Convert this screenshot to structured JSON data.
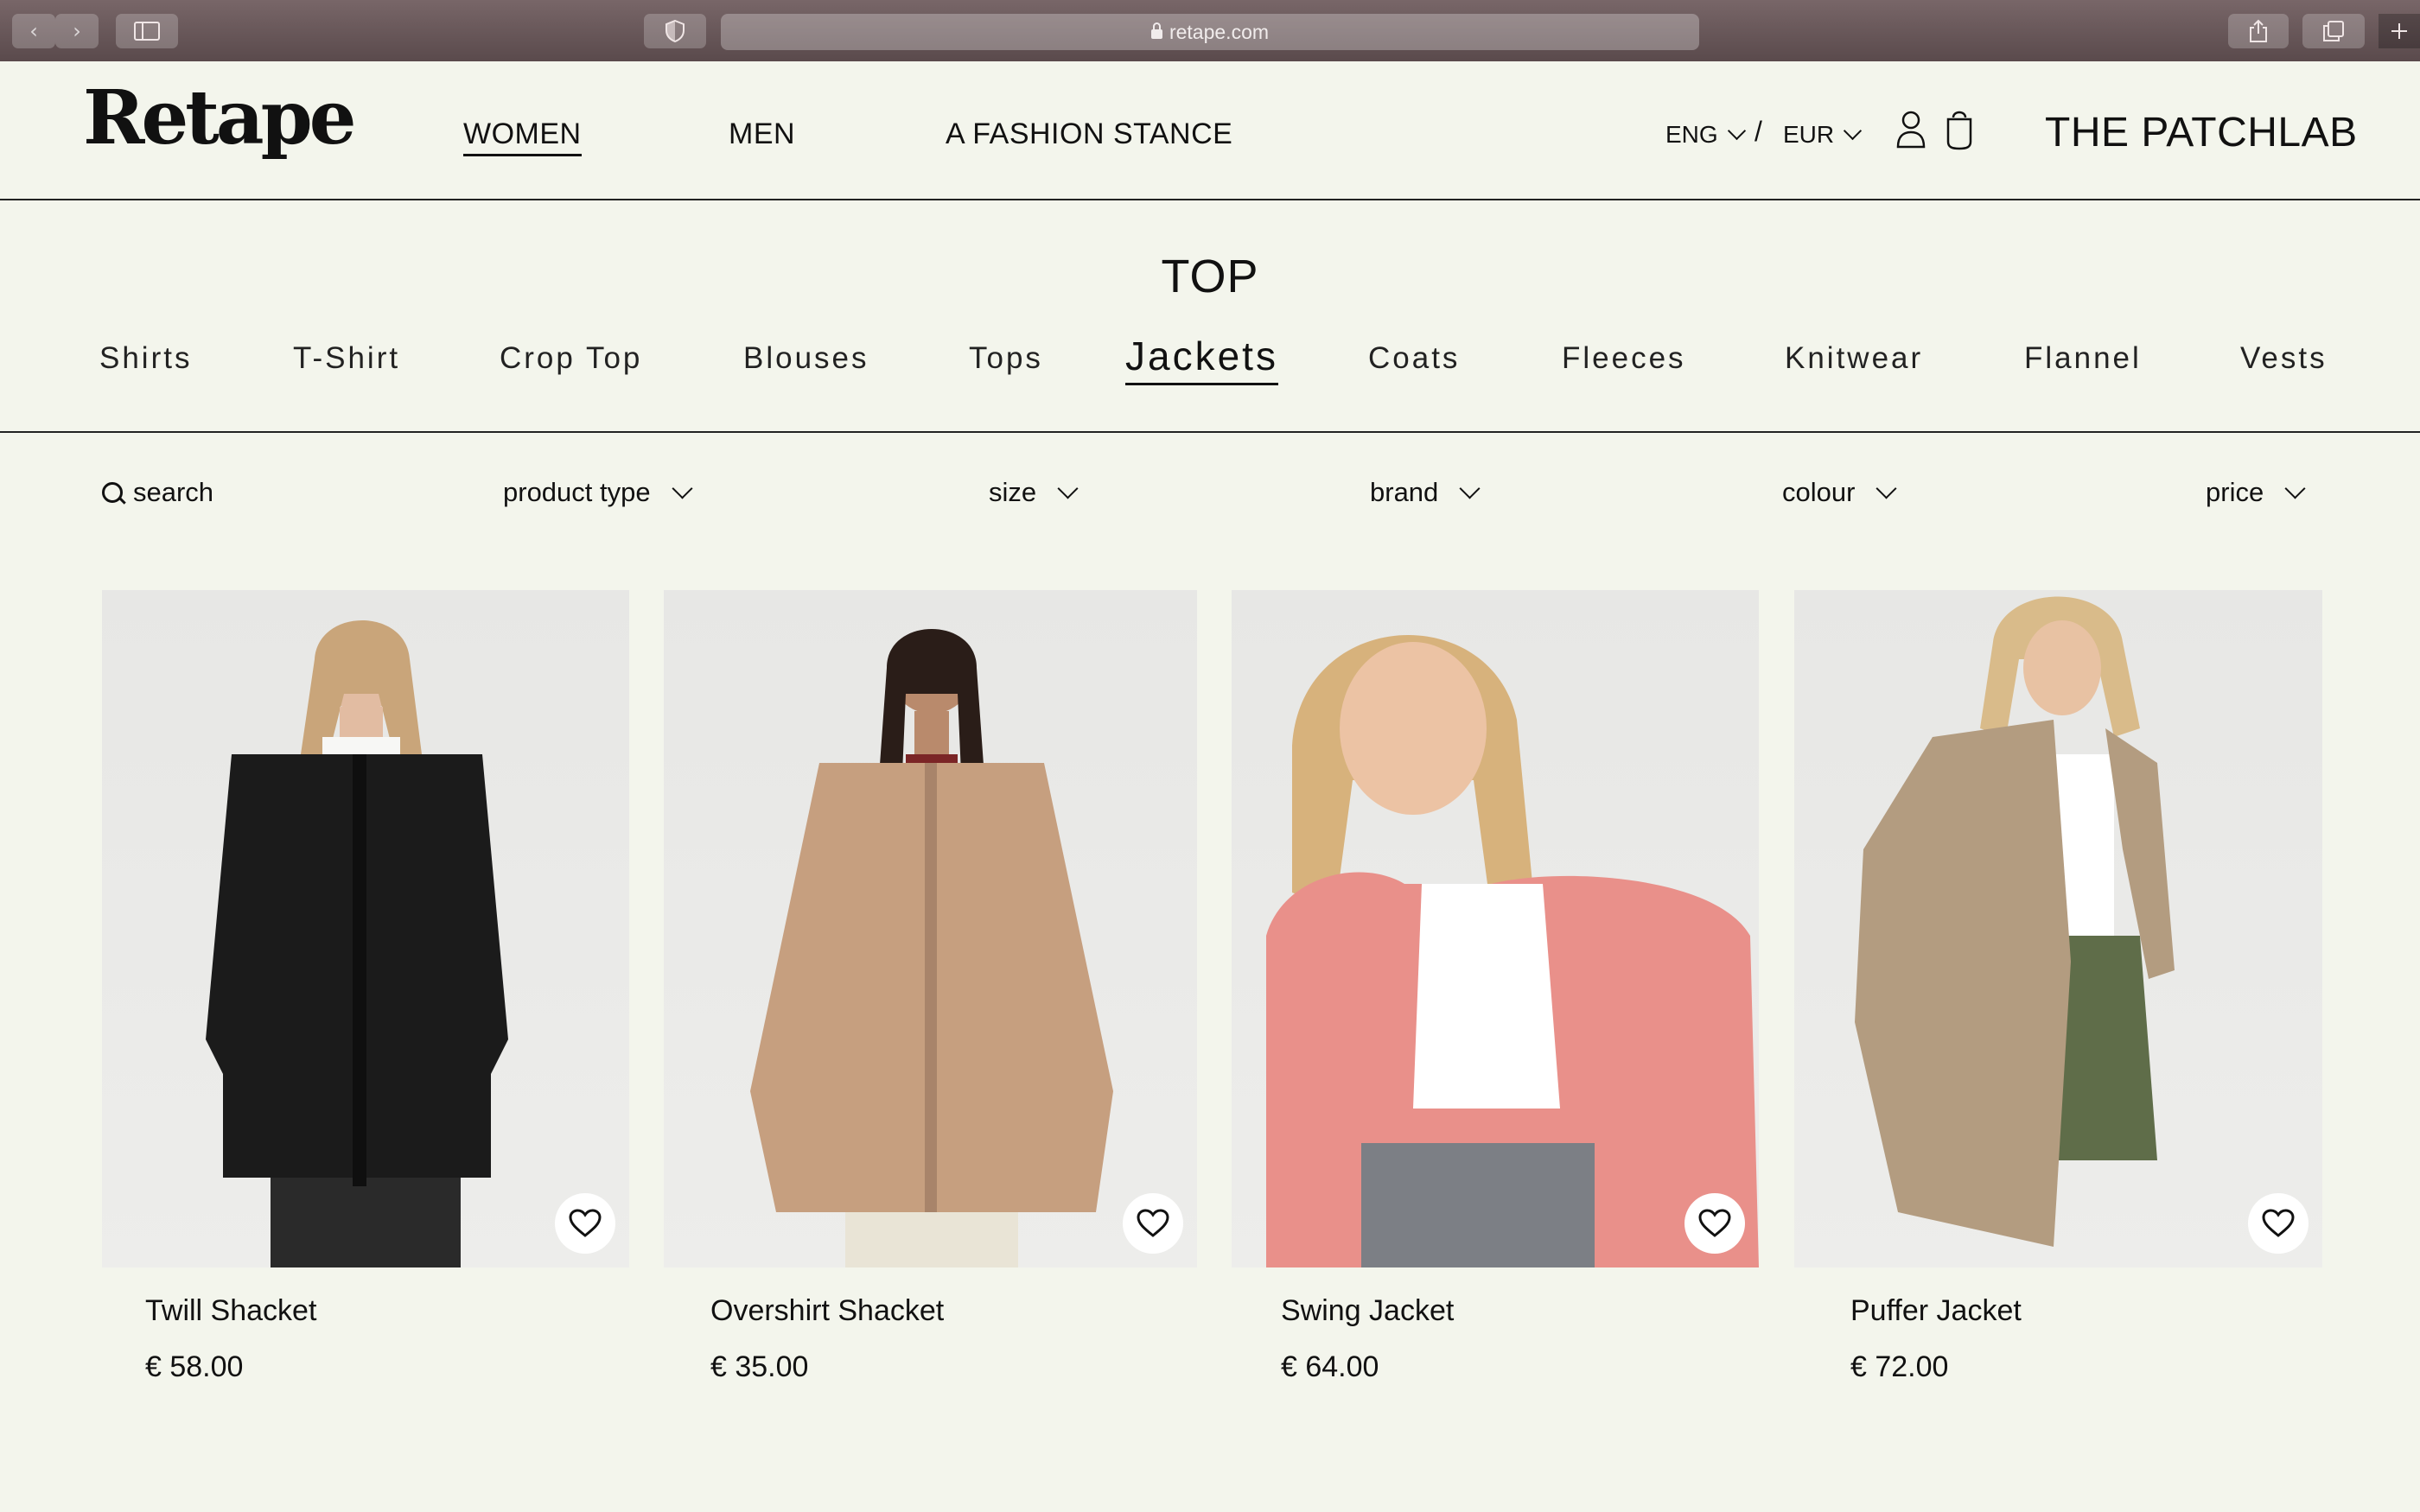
{
  "browser": {
    "url": "retape.com"
  },
  "header": {
    "logo": "Retape",
    "nav": [
      "WOMEN",
      "MEN",
      "A FASHION STANCE"
    ],
    "language": "ENG",
    "currency": "EUR",
    "separator": "/",
    "brand": "THE PATCHLAB"
  },
  "category": {
    "title": "TOP",
    "subcategories": [
      "Shirts",
      "T-Shirt",
      "Crop Top",
      "Blouses",
      "Tops",
      "Jackets",
      "Coats",
      "Fleeces",
      "Knitwear",
      "Flannel",
      "Vests"
    ],
    "active": "Jackets"
  },
  "filters": {
    "search": "search",
    "product_type": "product type",
    "size": "size",
    "brand": "brand",
    "colour": "colour",
    "price": "price"
  },
  "products": [
    {
      "name": "Twill Shacket",
      "price": "€ 58.00",
      "color": "#1b1b1b"
    },
    {
      "name": "Overshirt Shacket",
      "price": "€ 35.00",
      "color": "#c69f7f"
    },
    {
      "name": "Swing Jacket",
      "price": "€ 64.00",
      "color": "#e9908a"
    },
    {
      "name": "Puffer Jacket",
      "price": "€ 72.00",
      "color": "#b39c80"
    }
  ],
  "colors": {
    "background": "#f3f5ec",
    "text": "#111111",
    "chrome": "#6a585a"
  }
}
